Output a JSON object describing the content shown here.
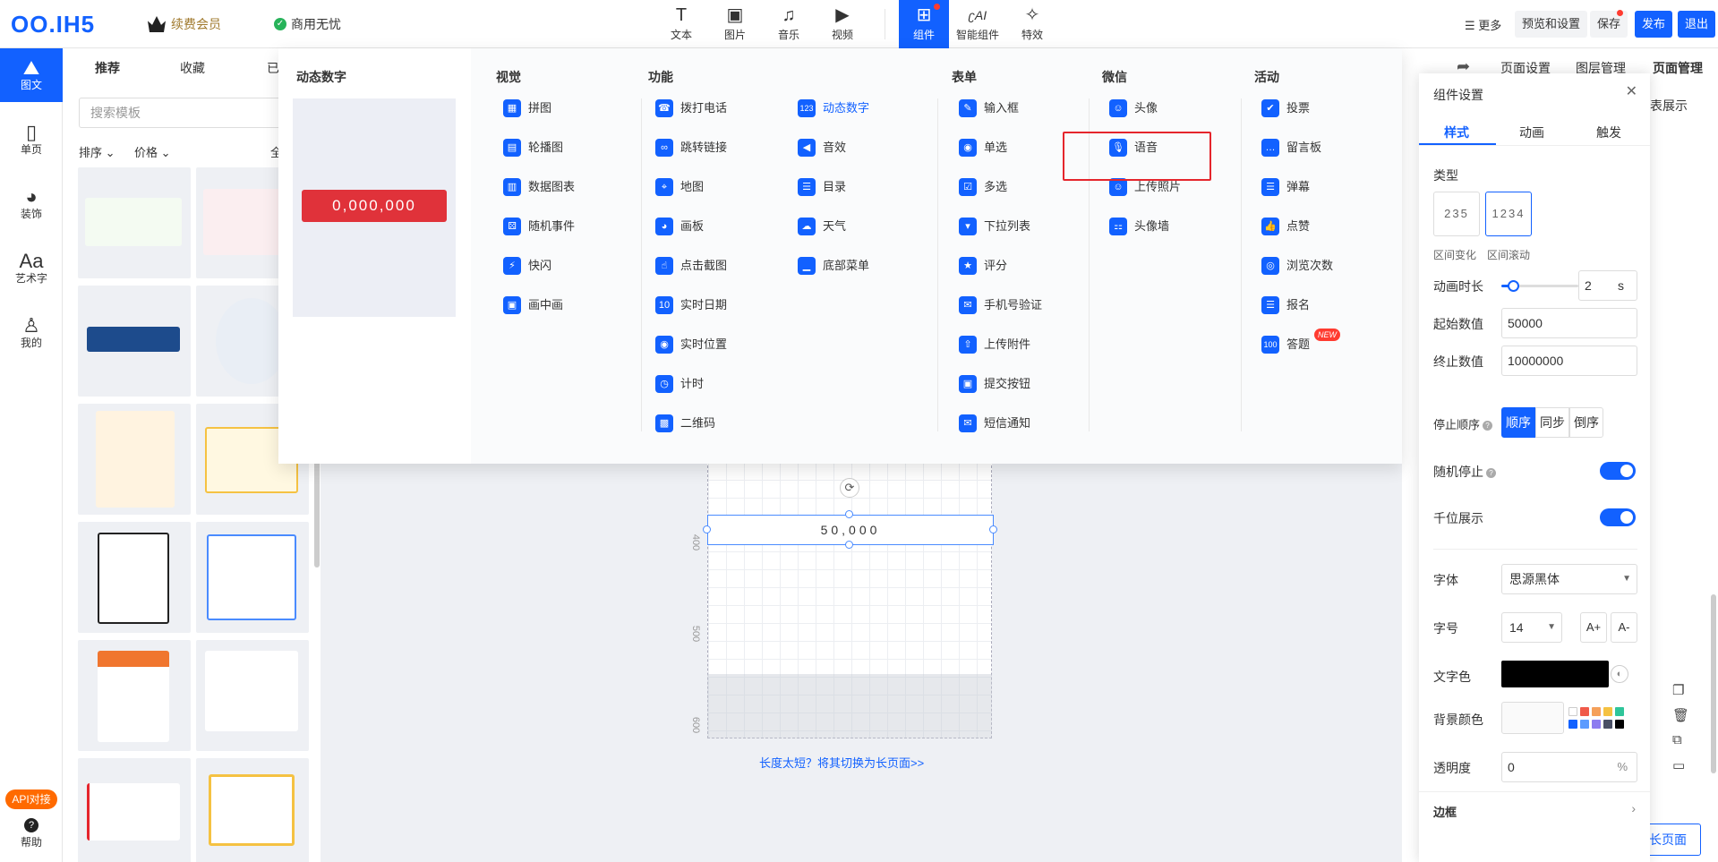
{
  "topbar": {
    "logo": "OO.IH5",
    "vip": "续费会员",
    "commercial": "商用无忧",
    "tools": [
      {
        "label": "文本",
        "icon": "text-icon"
      },
      {
        "label": "图片",
        "icon": "image-icon"
      },
      {
        "label": "音乐",
        "icon": "music-icon"
      },
      {
        "label": "视频",
        "icon": "video-icon"
      },
      {
        "label": "组件",
        "icon": "grid-icon"
      },
      {
        "label": "智能组件",
        "icon": "ai-icon"
      },
      {
        "label": "特效",
        "icon": "sparkle-icon"
      }
    ],
    "more": "更多",
    "preview_settings": "预览和设置",
    "save": "保存",
    "publish": "发布",
    "exit": "退出"
  },
  "leftnav": {
    "items": [
      "图文",
      "单页",
      "装饰",
      "艺术字",
      "我的"
    ],
    "api": "API对接",
    "help": "帮助"
  },
  "templates": {
    "tabs": [
      "推荐",
      "收藏",
      "已"
    ],
    "search_placeholder": "搜索模板",
    "sort": "排序",
    "price": "价格",
    "all": "全"
  },
  "canvas": {
    "ruler": [
      "400",
      "500",
      "600"
    ],
    "selected_text": "50,000",
    "switch_link": "长度太短？将其切换为长页面>>"
  },
  "dropdown": {
    "preview_title": "动态数字",
    "preview_number": "0,000,000",
    "columns": [
      {
        "title": "视觉",
        "items": [
          "拼图",
          "轮播图",
          "数据图表",
          "随机事件",
          "快闪",
          "画中画"
        ]
      },
      {
        "title": "功能",
        "items": [
          "拨打电话",
          "跳转链接",
          "地图",
          "画板",
          "点击截图",
          "实时日期",
          "实时位置",
          "计时",
          "二维码"
        ]
      },
      {
        "title": "",
        "items": [
          "动态数字",
          "音效",
          "目录",
          "天气",
          "底部菜单"
        ]
      },
      {
        "title": "表单",
        "items": [
          "输入框",
          "单选",
          "多选",
          "下拉列表",
          "评分",
          "手机号验证",
          "上传附件",
          "提交按钮",
          "短信通知"
        ]
      },
      {
        "title": "微信",
        "items": [
          "头像",
          "语音",
          "上传照片",
          "头像墙"
        ]
      },
      {
        "title": "活动",
        "items": [
          "投票",
          "留言板",
          "弹幕",
          "点赞",
          "浏览次数",
          "报名",
          "答题"
        ]
      }
    ],
    "new_badge": "NEW"
  },
  "rightpanel": {
    "tabs": [
      "页面设置",
      "图层管理",
      "页面管理"
    ],
    "partial": "表展示",
    "bottom_btn_partial": "长页面"
  },
  "settings": {
    "title": "组件设置",
    "tabs": [
      "样式",
      "动画",
      "触发"
    ],
    "type_label": "类型",
    "type_opt1": "235",
    "type_opt2": "1234",
    "type_cap1": "区间变化",
    "type_cap2": "区间滚动",
    "duration_label": "动画时长",
    "duration_value": "2",
    "duration_unit": "s",
    "duration_fraction": 0.15,
    "start_label": "起始数值",
    "start_value": "50000",
    "end_label": "终止数值",
    "end_value": "10000000",
    "stop_order_label": "停止顺序",
    "stop_options": [
      "顺序",
      "同步",
      "倒序"
    ],
    "random_stop_label": "随机停止",
    "thousands_label": "千位展示",
    "font_label": "字体",
    "font_value": "思源黑体",
    "size_label": "字号",
    "size_value": "14",
    "size_up": "A+",
    "size_down": "A-",
    "text_color_label": "文字色",
    "text_color": "#000000",
    "bg_color_label": "背景颜色",
    "opacity_label": "透明度",
    "opacity_value": "0",
    "opacity_unit": "%",
    "border_label": "边框",
    "swatches": [
      "#ffffff",
      "#f05a4a",
      "#f5a05a",
      "#f5c242",
      "#2fc59a",
      "#1261ff",
      "#5b9bff",
      "#8d7cf0",
      "#4a5066",
      "#000000"
    ]
  },
  "colors": {
    "accent": "#1261ff",
    "highlight": "#e5252c",
    "preview_red": "#e0323a"
  }
}
